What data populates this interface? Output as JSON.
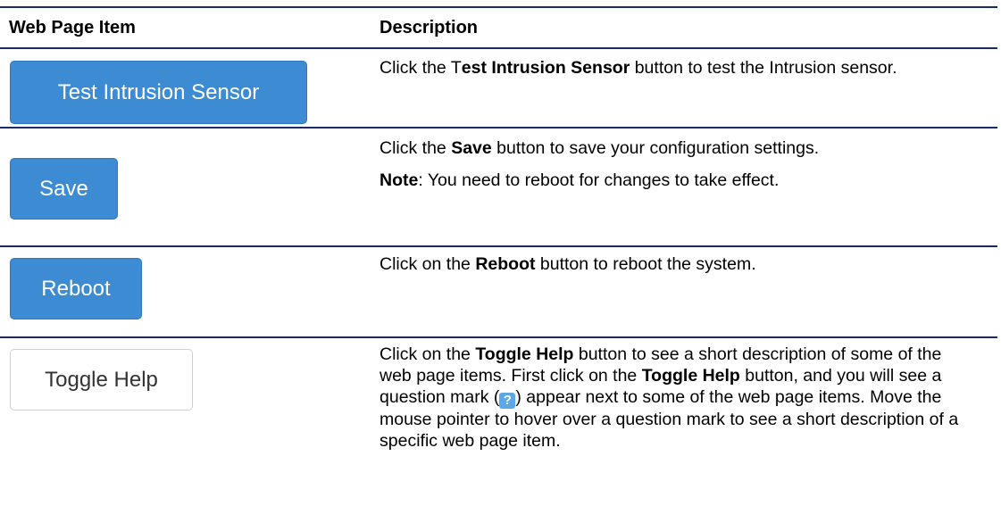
{
  "table": {
    "headers": {
      "item": "Web Page Item",
      "description": "Description"
    },
    "rows": [
      {
        "button_label": "Test Intrusion Sensor",
        "button_style": "primary",
        "desc": {
          "t1": "Click the T",
          "b1": "est Intrusion Sensor",
          "t2": " button to test the Intrusion sensor."
        }
      },
      {
        "button_label": "Save",
        "button_style": "primary",
        "desc": {
          "t1": "Click the ",
          "b1": "Save",
          "t2": " button to save your configuration settings.",
          "note_label": "Note",
          "note_text": ": You need to reboot for changes to take effect."
        }
      },
      {
        "button_label": "Reboot",
        "button_style": "primary",
        "desc": {
          "t1": "Click on the ",
          "b1": "Reboot",
          "t2": " button to reboot the system."
        }
      },
      {
        "button_label": "Toggle Help",
        "button_style": "default",
        "desc": {
          "t1": "Click on the ",
          "b1": "Toggle Help",
          "t2": " button to see a short description of some of the web page items. First click on the ",
          "b2": "Toggle Help",
          "t3": " button, and you will see a question mark (",
          "icon": "?",
          "t4": ") appear next to some of the web page items. Move the mouse pointer to hover over a question mark to see a short description of a specific web page item."
        }
      }
    ]
  },
  "colors": {
    "rule": "#1a2a6c",
    "primary_button": "#3c8bd3",
    "help_icon": "#5aa9e6"
  }
}
